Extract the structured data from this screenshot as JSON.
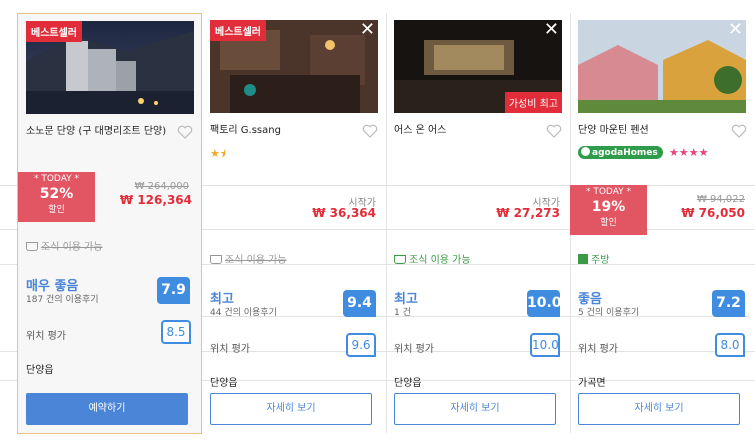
{
  "hotels": [
    {
      "badge": "베스트셀러",
      "name": "소노문 단양 (구 대명리조트 단양)",
      "stars": "★★★★★",
      "today": {
        "label": "* TODAY *",
        "pct": "52%",
        "suffix": "할인"
      },
      "old_price": "₩ 264,000",
      "price": "₩ 126,364",
      "breakfast": "조식 이용 가능",
      "rating_word": "매우 좋음",
      "review_count": "187 건의 이용후기",
      "score": "7.9",
      "location_label": "위치 평가",
      "location_score": "8.5",
      "area": "단양읍",
      "button": "예약하기"
    },
    {
      "badge": "베스트셀러",
      "name": "팩토리 G.ssang",
      "stars": "★⯨",
      "start_label": "시작가",
      "price": "₩ 36,364",
      "breakfast": "조식 이용 가능",
      "rating_word": "최고",
      "review_count": "44 건의 이용후기",
      "score": "9.4",
      "location_label": "위치 평가",
      "location_score": "9.6",
      "area": "단양읍",
      "button": "자세히 보기"
    },
    {
      "name": "어스 온 어스",
      "value_badge": "가성비 최고",
      "start_label": "시작가",
      "price": "₩ 27,273",
      "breakfast": "조식 이용 가능",
      "rating_word": "최고",
      "review_count": "1 건",
      "score": "10.0",
      "location_label": "위치 평가",
      "location_score": "10.0",
      "area": "단양읍",
      "button": "자세히 보기"
    },
    {
      "name": "단양 마운틴 펜션",
      "agoda_badge": "agodaHomes",
      "stars": "★★★★",
      "today": {
        "label": "* TODAY *",
        "pct": "19%",
        "suffix": "할인"
      },
      "old_price": "₩ 94,022",
      "price": "₩ 76,050",
      "kitchen": "주방",
      "rating_word": "좋음",
      "review_count": "5 건의 이용후기",
      "score": "7.2",
      "location_label": "위치 평가",
      "location_score": "8.0",
      "area": "가곡면",
      "button": "자세히 보기"
    }
  ],
  "colors": {
    "accent": "#4a85d8",
    "sale": "#e12d39",
    "highlight_border": "#e7c27a"
  }
}
